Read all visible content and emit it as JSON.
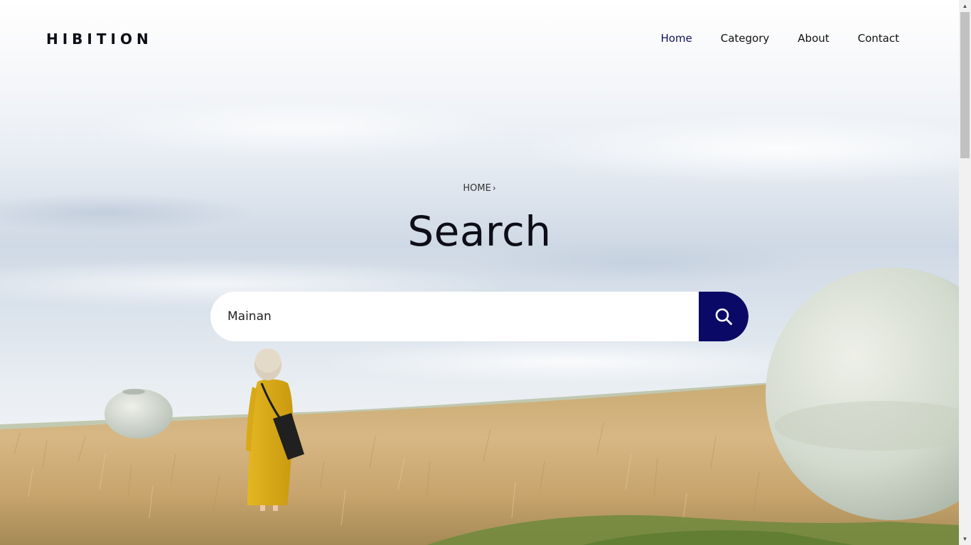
{
  "header": {
    "logo": "HIBITION",
    "nav": [
      {
        "label": "Home",
        "active": true
      },
      {
        "label": "Category",
        "active": false
      },
      {
        "label": "About",
        "active": false
      },
      {
        "label": "Contact",
        "active": false
      }
    ]
  },
  "hero": {
    "breadcrumb": {
      "label": "HOME",
      "separator_icon": "chevron-right-icon"
    },
    "title": "Search",
    "search": {
      "value": "Mainan",
      "button_icon": "search-icon",
      "button_color": "#0a0a66"
    }
  },
  "colors": {
    "accent": "#0a0a66",
    "nav_active": "#12125a"
  }
}
